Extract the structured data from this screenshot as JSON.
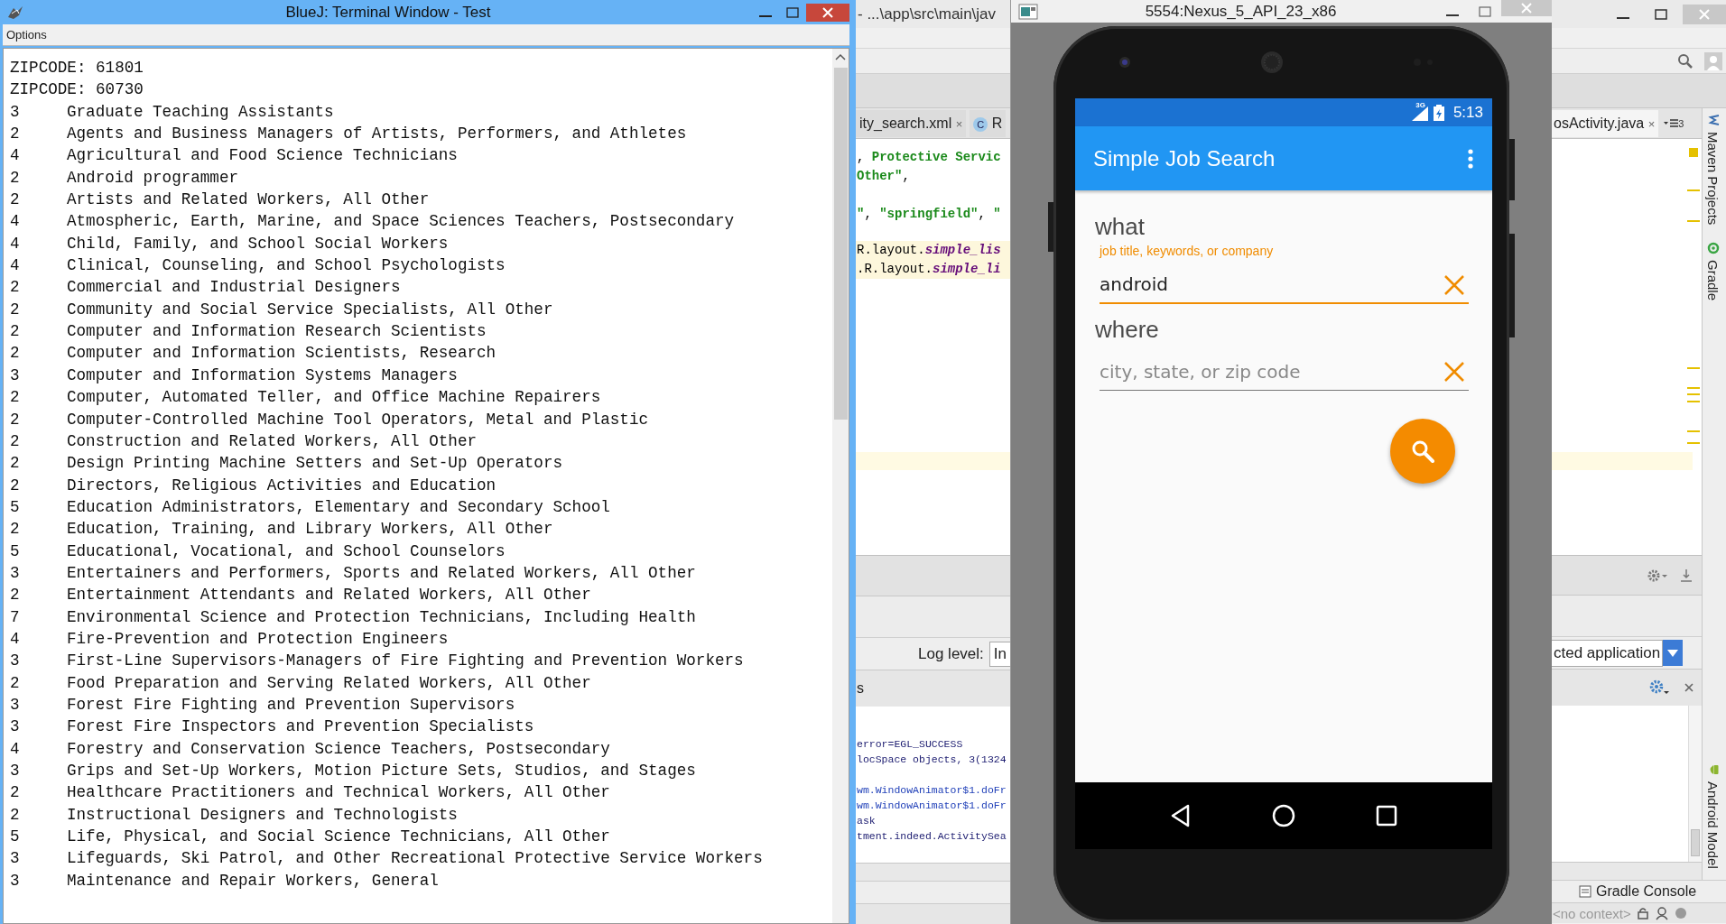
{
  "terminal": {
    "title": "BlueJ: Terminal Window - Test",
    "menu": [
      "Options"
    ],
    "header_lines": [
      "ZIPCODE: 61801",
      "ZIPCODE: 60730"
    ],
    "rows": [
      {
        "count": "3",
        "title": "Graduate Teaching Assistants"
      },
      {
        "count": "2",
        "title": "Agents and Business Managers of Artists, Performers, and Athletes"
      },
      {
        "count": "4",
        "title": "Agricultural and Food Science Technicians"
      },
      {
        "count": "2",
        "title": "Android programmer"
      },
      {
        "count": "2",
        "title": "Artists and Related Workers, All Other"
      },
      {
        "count": "4",
        "title": "Atmospheric, Earth, Marine, and Space Sciences Teachers, Postsecondary"
      },
      {
        "count": "4",
        "title": "Child, Family, and School Social Workers"
      },
      {
        "count": "4",
        "title": "Clinical, Counseling, and School Psychologists"
      },
      {
        "count": "2",
        "title": "Commercial and Industrial Designers"
      },
      {
        "count": "2",
        "title": "Community and Social Service Specialists, All Other"
      },
      {
        "count": "2",
        "title": "Computer and Information Research Scientists"
      },
      {
        "count": "2",
        "title": "Computer and Information Scientists, Research"
      },
      {
        "count": "3",
        "title": "Computer and Information Systems Managers"
      },
      {
        "count": "2",
        "title": "Computer, Automated Teller, and Office Machine Repairers"
      },
      {
        "count": "2",
        "title": "Computer-Controlled Machine Tool Operators, Metal and Plastic"
      },
      {
        "count": "2",
        "title": "Construction and Related Workers, All Other"
      },
      {
        "count": "2",
        "title": "Design Printing Machine Setters and Set-Up Operators"
      },
      {
        "count": "2",
        "title": "Directors, Religious Activities and Education"
      },
      {
        "count": "5",
        "title": "Education Administrators, Elementary and Secondary School"
      },
      {
        "count": "2",
        "title": "Education, Training, and Library Workers, All Other"
      },
      {
        "count": "5",
        "title": "Educational, Vocational, and School Counselors"
      },
      {
        "count": "3",
        "title": "Entertainers and Performers, Sports and Related Workers, All Other"
      },
      {
        "count": "2",
        "title": "Entertainment Attendants and Related Workers, All Other"
      },
      {
        "count": "7",
        "title": "Environmental Science and Protection Technicians, Including Health"
      },
      {
        "count": "4",
        "title": "Fire-Prevention and Protection Engineers"
      },
      {
        "count": "3",
        "title": "First-Line Supervisors-Managers of Fire Fighting and Prevention Workers"
      },
      {
        "count": "2",
        "title": "Food Preparation and Serving Related Workers, All Other"
      },
      {
        "count": "3",
        "title": "Forest Fire Fighting and Prevention Supervisors"
      },
      {
        "count": "3",
        "title": "Forest Fire Inspectors and Prevention Specialists"
      },
      {
        "count": "4",
        "title": "Forestry and Conservation Science Teachers, Postsecondary"
      },
      {
        "count": "3",
        "title": "Grips and Set-Up Workers, Motion Picture Sets, Studios, and Stages"
      },
      {
        "count": "2",
        "title": "Healthcare Practitioners and Technical Workers, All Other"
      },
      {
        "count": "2",
        "title": "Instructional Designers and Technologists"
      },
      {
        "count": "5",
        "title": "Life, Physical, and Social Science Technicians, All Other"
      },
      {
        "count": "3",
        "title": "Lifeguards, Ski Patrol, and Other Recreational Protective Service Workers"
      },
      {
        "count": "3",
        "title": "Maintenance and Repair Workers, General"
      }
    ]
  },
  "ide": {
    "title": "- ...\\app\\src\\main\\jav",
    "editor_tabs": [
      {
        "label": "ity_search.xml",
        "close": "×"
      },
      {
        "label": "R",
        "icon": "C"
      },
      {
        "label": "osActivity.java",
        "close": "×"
      }
    ],
    "tab_overflow_count": "3",
    "code_lines": [
      {
        "highlighted": false,
        "segments": [
          {
            "kind": "plain",
            "text": ", "
          },
          {
            "kind": "string",
            "text": "Protective Servic"
          }
        ]
      },
      {
        "highlighted": false,
        "segments": [
          {
            "kind": "string",
            "text": " Other\""
          },
          {
            "kind": "plain",
            "text": ","
          }
        ]
      },
      {
        "highlighted": false,
        "segments": [
          {
            "kind": "string",
            "text": "\""
          },
          {
            "kind": "plain",
            "text": ", "
          },
          {
            "kind": "string",
            "text": "\"springfield\""
          },
          {
            "kind": "plain",
            "text": ", "
          },
          {
            "kind": "string",
            "text": "\""
          }
        ]
      },
      {
        "highlighted": true,
        "segments": [
          {
            "kind": "plain",
            "text": "R.layout."
          },
          {
            "kind": "field",
            "text": "simple_lis"
          }
        ]
      },
      {
        "highlighted": true,
        "segments": [
          {
            "kind": "plain",
            "text": ".R.layout."
          },
          {
            "kind": "field",
            "text": "simple_li"
          }
        ]
      }
    ],
    "log_level_label": "Log level:",
    "log_level_value": "In",
    "process_value": "cted application",
    "panel_title": "s",
    "log_lines": [
      "error=EGL_SUCCESS",
      "locSpace objects, 3(1324",
      "wm.WindowAnimator$1.doFr",
      "wm.WindowAnimator$1.doFr",
      "ask",
      "tment.indeed.ActivitySea"
    ],
    "tool_windows": [
      {
        "label": "Maven Projects",
        "kind": "maven"
      },
      {
        "label": "Gradle",
        "kind": "gradle"
      },
      {
        "label": "Android Model",
        "kind": "android"
      }
    ],
    "bottom_tab": "Gradle Console",
    "status_context": "<no context>"
  },
  "emulator": {
    "title": "5554:Nexus_5_API_23_x86",
    "status_bar": {
      "network": "3G",
      "time": "5:13"
    },
    "app_bar_title": "Simple Job Search",
    "fields": [
      {
        "label": "what",
        "hint": "job title, keywords, or company",
        "value": "android",
        "focused": true
      },
      {
        "label": "where",
        "placeholder": "city, state, or zip code",
        "focused": false
      }
    ]
  }
}
